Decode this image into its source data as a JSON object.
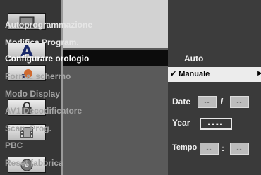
{
  "menu": {
    "items": [
      {
        "label": "Autoprogrammazione"
      },
      {
        "label": "Modifica Program."
      },
      {
        "label": "Configurare orologio"
      },
      {
        "label": "Forma. schermo"
      },
      {
        "label": "Modo Display"
      },
      {
        "label": "AV1 Decodificatore"
      },
      {
        "label": "Scan. Prog."
      },
      {
        "label": "PBC"
      },
      {
        "label": "Reset fabbrica"
      }
    ],
    "selected_index": 2
  },
  "icons": [
    {
      "name": "tv-screen-icon"
    },
    {
      "name": "language-a-icon"
    },
    {
      "name": "audio-speaker-icon"
    },
    {
      "name": "padlock-icon"
    },
    {
      "name": "film-strip-icon"
    },
    {
      "name": "disc-icon"
    }
  ],
  "clock": {
    "auto_label": "Auto",
    "manual_check": "✔",
    "manual_label": "Manuale",
    "manual_arrow": "►",
    "date_label": "Date",
    "date_day": "--",
    "date_sep": "/",
    "date_month": "--",
    "year_label": "Year",
    "year_value": "----",
    "time_label": "Tempo",
    "time_hour": "--",
    "time_sep": ":",
    "time_min": "--"
  },
  "colors": {
    "selected_bar": "#0c0c0c",
    "highlight_bar": "#ececec",
    "menu_text": "#a4a4a4"
  }
}
